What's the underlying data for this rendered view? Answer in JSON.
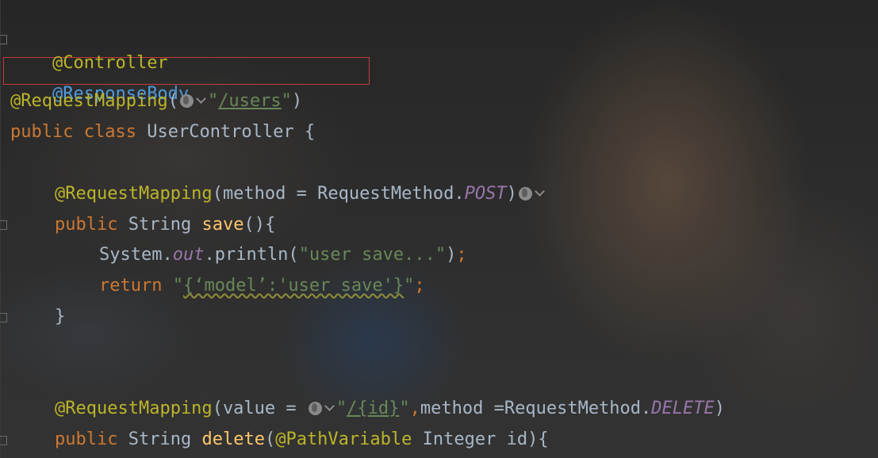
{
  "editor": {
    "lines": {
      "l1": {
        "annotation": "@Controller"
      },
      "l2": {
        "annotation": "@ResponseBody"
      },
      "l3": {
        "annotation": "@RequestMapping",
        "open": "(",
        "quote_open": "\"",
        "path": "/users",
        "quote_close": "\"",
        "close": ")"
      },
      "l4": {
        "kw1": "public",
        "kw2": "class",
        "class_name": "UserController",
        "brace": "{"
      },
      "l6": {
        "annotation": "@RequestMapping",
        "open": "(",
        "param": "method = RequestMethod.",
        "const": "POST",
        "close": ")"
      },
      "l7": {
        "kw": "public",
        "type": "String",
        "method": "save",
        "rest": "(){"
      },
      "l8": {
        "obj": "System.",
        "field": "out",
        "call": ".println(",
        "string": "\"user save...\"",
        "paren": ")",
        "semi": ";"
      },
      "l9": {
        "kw": "return",
        "q1": "\"",
        "wavy": "{‘model’:'user save'}",
        "q2": "\"",
        "semi": ";"
      },
      "l10": {
        "brace": "}"
      },
      "l13": {
        "annotation": "@RequestMapping",
        "open": "(",
        "param": "value = ",
        "q1": "\"",
        "path": "/{id}",
        "q2": "\"",
        "comma": ",",
        "param2": "method =RequestMethod.",
        "const": "DELETE",
        "close": ")"
      },
      "l14": {
        "kw": "public",
        "type": "String",
        "method": "delete",
        "open": "(",
        "annotation": "@PathVariable",
        "param": "Integer id",
        "close": "){"
      }
    },
    "icons": [
      "globe-icon",
      "chevron-down-icon"
    ],
    "colors": {
      "annotation": "#bbb529",
      "keyword": "#cc7832",
      "identifier": "#a9b7c6",
      "string": "#6a8759",
      "method": "#ffc66d",
      "constant": "#9876aa",
      "highlight_border": "#c43b3b"
    }
  }
}
